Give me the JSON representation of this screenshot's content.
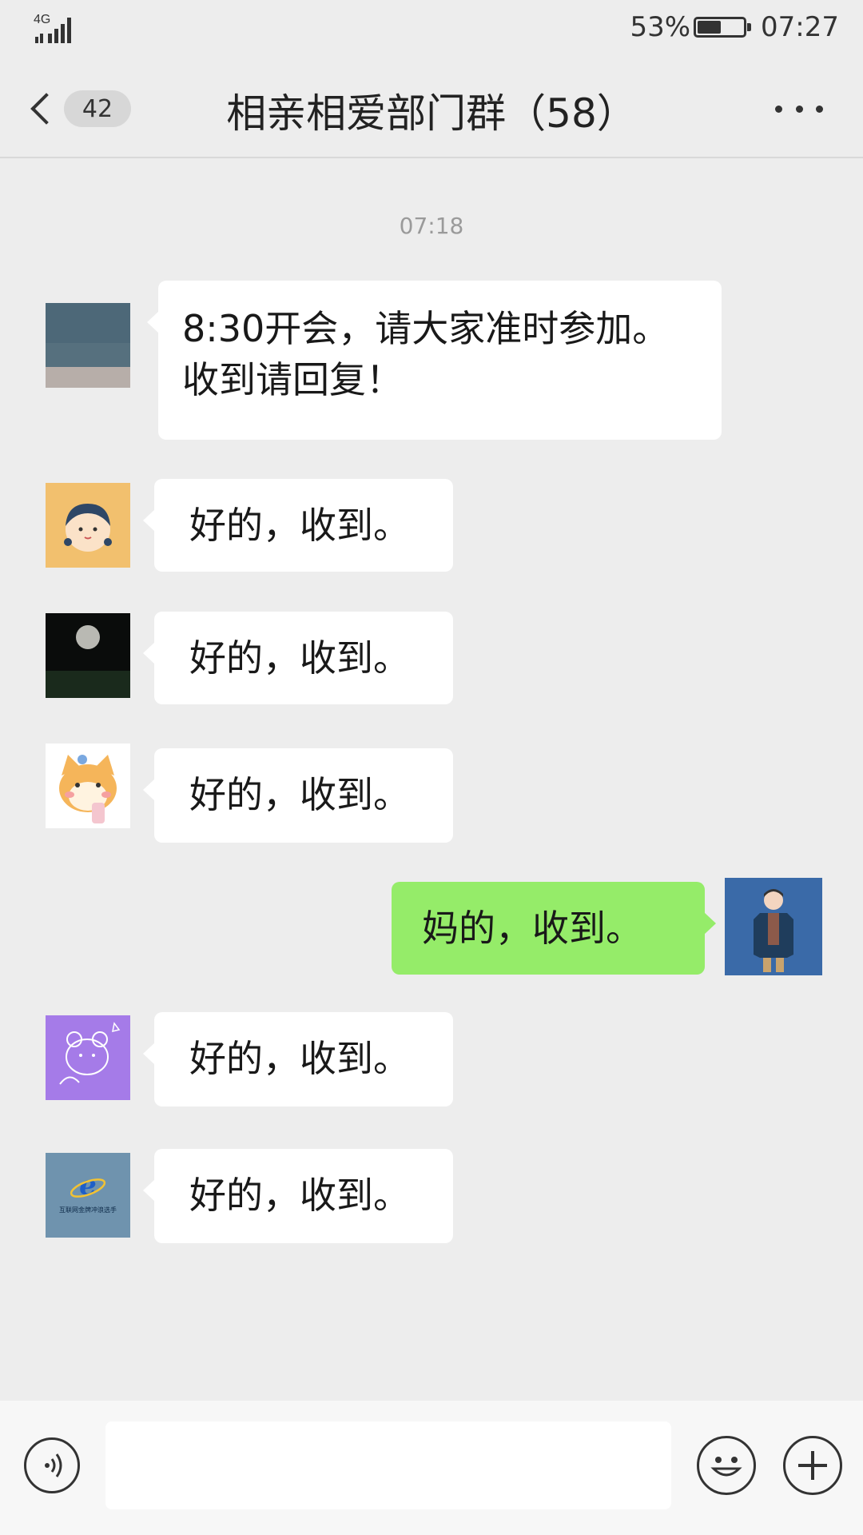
{
  "status_bar": {
    "network": "4G",
    "battery_percent": "53%",
    "battery_level": 0.53,
    "time": "07:27"
  },
  "nav": {
    "unread_count": "42",
    "title": "相亲相爱部门群（58）"
  },
  "chat": {
    "timestamp": "07:18",
    "messages": [
      {
        "side": "left",
        "line1": "8:30开会，请大家准时参加。",
        "line2": "收到请回复！"
      },
      {
        "side": "left",
        "text": "好的，收到。"
      },
      {
        "side": "left",
        "text": "好的，收到。"
      },
      {
        "side": "left",
        "text": "好的，收到。"
      },
      {
        "side": "right",
        "text": "妈的，收到。"
      },
      {
        "side": "left",
        "text": "好的，收到。"
      },
      {
        "side": "left",
        "text": "好的，收到。",
        "avatar_caption": "互联网金牌冲浪选手"
      }
    ]
  },
  "colors": {
    "background": "#ededed",
    "sent_bubble": "#95ec69",
    "received_bubble": "#ffffff"
  },
  "icons": {
    "signal": "signal-icon",
    "battery": "battery-icon",
    "back": "chevron-left-icon",
    "more": "more-dots-icon",
    "voice": "voice-icon",
    "emoji": "emoji-icon",
    "plus": "plus-icon"
  }
}
